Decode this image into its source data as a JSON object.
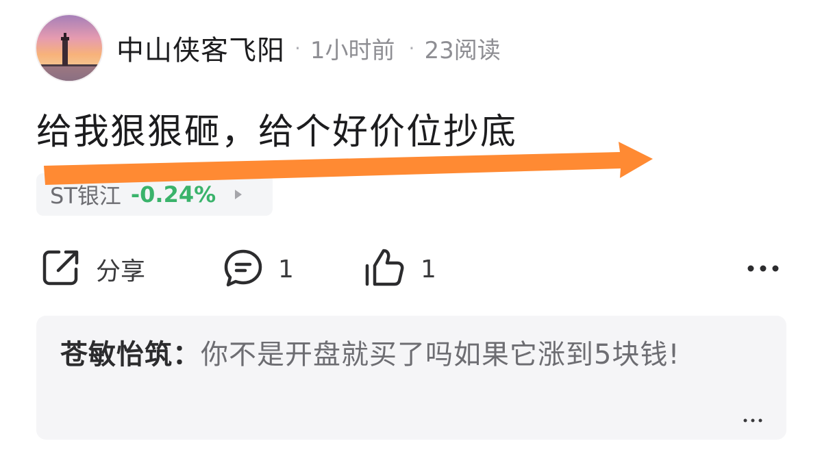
{
  "post": {
    "author": "中山侠客飞阳",
    "time": "1小时前",
    "reads": "23阅读",
    "separator": "·",
    "content": "给我狠狠砸，给个好价位抄底"
  },
  "stock": {
    "name": "ST银江",
    "change": "-0.24%",
    "change_color": "#3ab36b"
  },
  "actions": {
    "share_label": "分享",
    "comment_count": "1",
    "like_count": "1"
  },
  "comment": {
    "author": "苍敏怡筑：",
    "text": "你不是开盘就买了吗如果它涨到5块钱!"
  },
  "colors": {
    "overlay_arrow": "#ff8a33",
    "comment_bg": "#f5f5f7",
    "stock_tag_bg": "#f4f5f7"
  },
  "icons": {
    "share": "share-out-icon",
    "comment": "comment-bubble-icon",
    "like": "thumbs-up-icon",
    "more": "more-dots-icon"
  }
}
